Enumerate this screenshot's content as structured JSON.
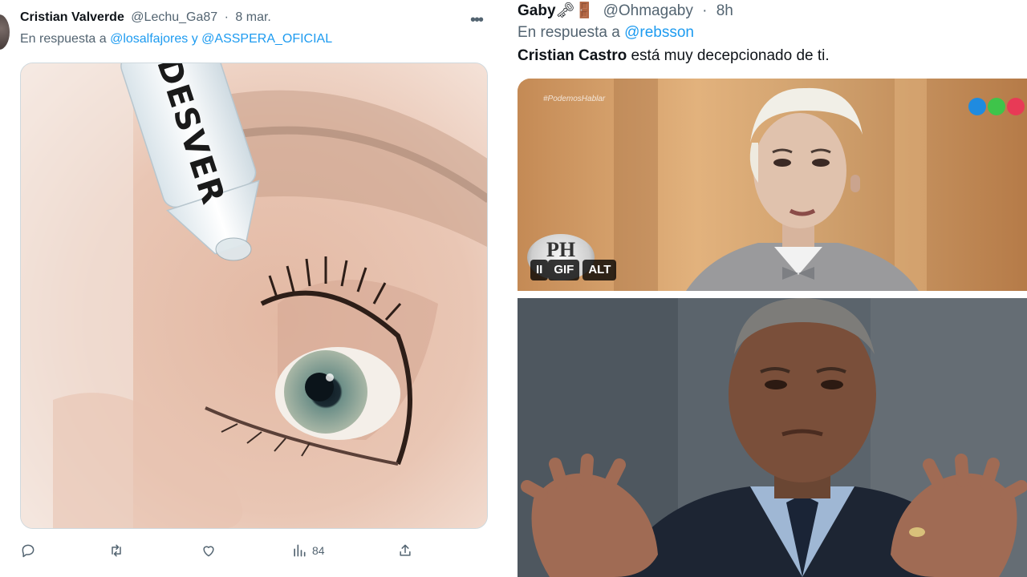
{
  "left_tweet": {
    "author_name": "Cristian Valverde",
    "handle": "@Lechu_Ga87",
    "date": "8 mar.",
    "reply_prefix": "En respuesta a",
    "reply_to_1": "@losalfajores",
    "reply_joiner": "y",
    "reply_to_2": "@ASSPERA_OFICIAL",
    "image_caption": "DESVER",
    "actions": {
      "views_count": "84"
    }
  },
  "right_tweet": {
    "author_name": "Gaby",
    "emoji": "🗝🚪",
    "handle": "@Ohmagaby",
    "time": "8h",
    "reply_prefix": "En respuesta a",
    "reply_to": "@rebsson",
    "text_bold": "Cristian Castro",
    "text_rest": " está muy decepcionado de ti.",
    "gif_overlay_tag": "#PodemosHablar",
    "logo_text": "PH",
    "gif_controls": {
      "pause": "II",
      "gif": "GIF",
      "alt": "ALT"
    }
  },
  "colors": {
    "link": "#1d9bf0",
    "secondary_text": "#536471",
    "primary_text": "#0f1419",
    "logo_blue": "#1f8be0",
    "logo_green": "#3ec44a",
    "logo_red": "#e83a56"
  }
}
